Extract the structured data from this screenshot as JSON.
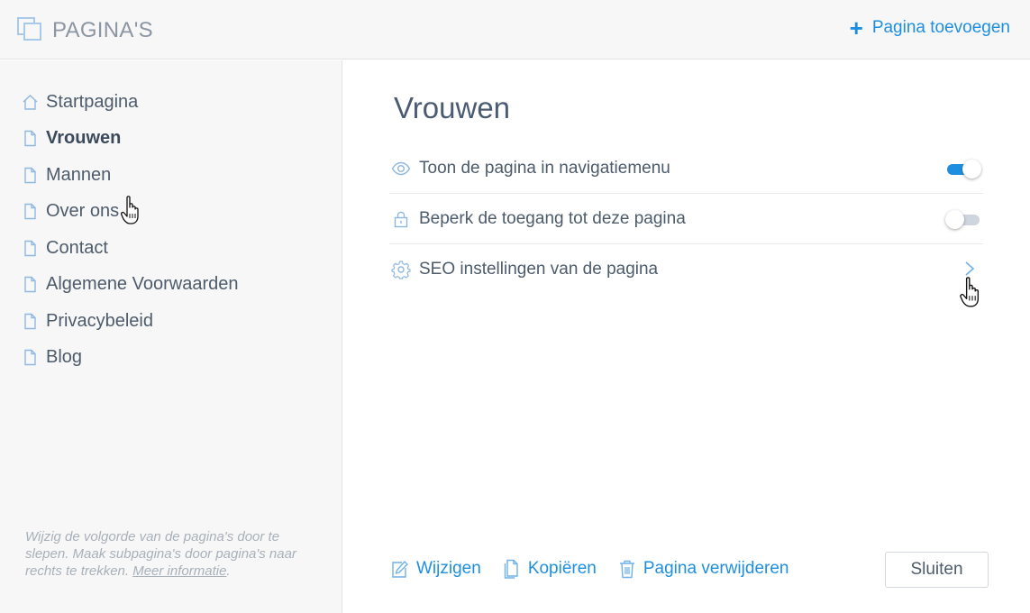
{
  "header": {
    "app_title": "PAGINA'S",
    "add_page_label": "Pagina toevoegen"
  },
  "sidebar": {
    "items": [
      {
        "label": "Startpagina",
        "icon": "home-icon"
      },
      {
        "label": "Vrouwen",
        "icon": "page-icon",
        "active": true
      },
      {
        "label": "Mannen",
        "icon": "page-icon"
      },
      {
        "label": "Over ons",
        "icon": "page-icon"
      },
      {
        "label": "Contact",
        "icon": "page-icon"
      },
      {
        "label": "Algemene Voorwaarden",
        "icon": "page-icon"
      },
      {
        "label": "Privacybeleid",
        "icon": "page-icon"
      },
      {
        "label": "Blog",
        "icon": "page-icon"
      }
    ],
    "help_text": "Wijzig de volgorde van de pagina's door te slepen. Maak subpagina's door pagina's naar rechts te trekken.",
    "help_link": "Meer informatie",
    "help_end": "."
  },
  "main": {
    "title": "Vrouwen",
    "settings": [
      {
        "label": "Toon de pagina in navigatiemenu",
        "icon": "eye-icon",
        "control": "toggle",
        "on": true
      },
      {
        "label": "Beperk de toegang tot deze pagina",
        "icon": "lock-icon",
        "control": "toggle",
        "on": false
      },
      {
        "label": "SEO instellingen van de pagina",
        "icon": "gear-icon",
        "control": "chevron"
      }
    ],
    "actions": {
      "edit": "Wijzigen",
      "copy": "Kopiëren",
      "delete": "Pagina verwijderen"
    },
    "close_label": "Sluiten"
  },
  "colors": {
    "accent": "#1e8fe0",
    "sidebar_bg": "#f7f7f7",
    "text": "#4d5b6b",
    "muted": "#a8b0ba"
  }
}
